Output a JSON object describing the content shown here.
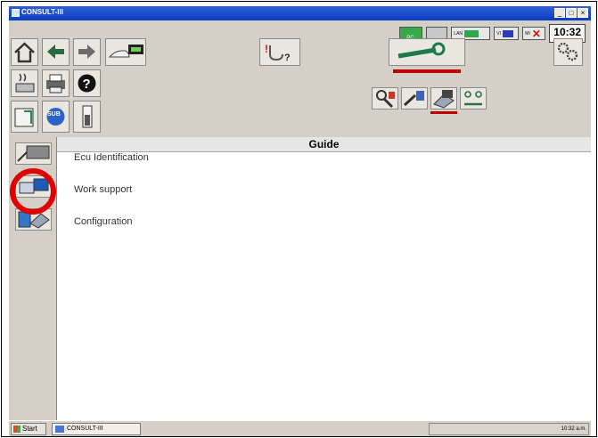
{
  "window": {
    "title": "CONSULT-III",
    "buttons": {
      "minimize": "_",
      "maximize": "□",
      "close": "×"
    }
  },
  "status": {
    "time": "10:32",
    "indicators": {
      "pc": "PC",
      "lan": "LAN",
      "vi": "VI",
      "mi": "MI"
    }
  },
  "toolbar": {
    "icons": {
      "home": "home-icon",
      "back": "arrow-left-icon",
      "forward": "arrow-right-icon",
      "vehicle": "vehicle-ecu-icon",
      "diagnosis": "stethoscope-icon",
      "repair": "wrench-icon",
      "settings": "gear-icon",
      "heater": "heater-icon",
      "print": "printer-icon",
      "help": "help-icon",
      "screen": "screen-capture-icon",
      "sub": "sub-mode-icon",
      "battery": "battery-icon",
      "tool1": "tool-1-icon",
      "tool2": "tool-2-icon",
      "tool3": "tool-3-icon",
      "tool4": "tool-4-icon"
    },
    "sub_label": "SUB"
  },
  "main": {
    "header": "Guide",
    "menu": [
      {
        "label": "Ecu Identification",
        "icon": "ecu-identification-icon"
      },
      {
        "label": "Work support",
        "icon": "work-support-icon"
      },
      {
        "label": "Configuration",
        "icon": "configuration-icon"
      }
    ]
  },
  "taskbar": {
    "start": "Start",
    "task": "CONSULT-III",
    "tray_time": "10:32 a.m."
  },
  "colors": {
    "title_bar": "#0a3cc0",
    "highlight_circle": "#e00000",
    "active_underline": "#c00000"
  }
}
